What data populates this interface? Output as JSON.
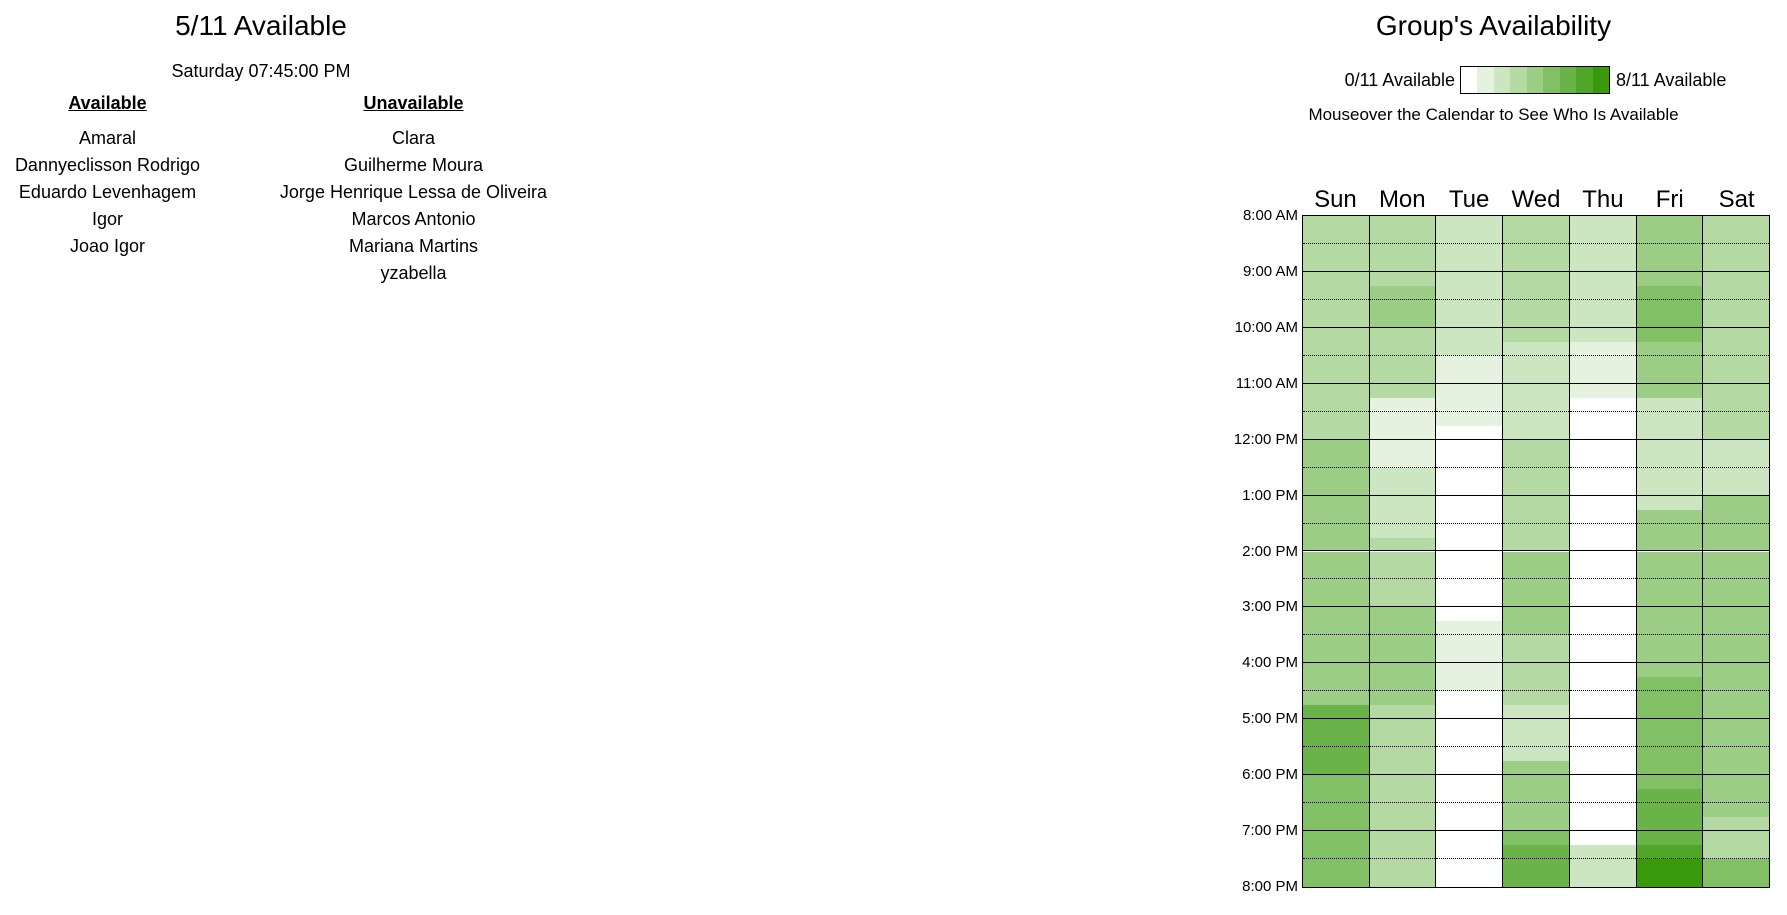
{
  "left_panel": {
    "title": "5/11 Available",
    "time": "Saturday 07:45:00 PM",
    "available_heading": "Available",
    "unavailable_heading": "Unavailable",
    "available": [
      "Amaral",
      "Dannyeclisson Rodrigo",
      "Eduardo Levenhagem",
      "Igor",
      "Joao Igor"
    ],
    "unavailable": [
      "Clara",
      "Guilherme Moura",
      "Jorge Henrique Lessa de Oliveira",
      "Marcos Antonio",
      "Mariana Martins",
      "yzabella"
    ]
  },
  "right_panel": {
    "title": "Group's Availability",
    "legend_min": "0/11 Available",
    "legend_max": "8/11 Available",
    "hint": "Mouseover the Calendar to See Who Is Available"
  },
  "legend_colors": [
    "#ffffff",
    "#e6f2e0",
    "#cde6c2",
    "#b4d9a3",
    "#9bcd85",
    "#82c066",
    "#69b348",
    "#50a629",
    "#389a0b"
  ],
  "days": [
    "Sun",
    "Mon",
    "Tue",
    "Wed",
    "Thu",
    "Fri",
    "Sat"
  ],
  "time_labels": [
    "8:00 AM",
    "9:00 AM",
    "10:00 AM",
    "11:00 AM",
    "12:00 PM",
    "1:00 PM",
    "2:00 PM",
    "3:00 PM",
    "4:00 PM",
    "5:00 PM",
    "6:00 PM",
    "7:00 PM",
    "8:00 PM"
  ],
  "availability_counts": {
    "Sun": [
      3,
      3,
      3,
      3,
      3,
      3,
      3,
      3,
      3,
      3,
      3,
      3,
      3,
      3,
      3,
      3,
      3,
      3,
      4,
      4,
      4,
      4,
      4,
      4,
      4,
      4,
      4,
      4,
      4,
      4,
      4,
      4,
      4,
      4,
      4,
      4,
      4,
      4,
      4,
      4,
      6,
      6,
      6,
      6,
      6,
      6,
      5,
      5,
      5,
      5,
      5,
      5,
      5,
      5,
      5,
      5
    ],
    "Mon": [
      3,
      3,
      3,
      3,
      3,
      3,
      3,
      3,
      4,
      4,
      4,
      4,
      3,
      3,
      3,
      3,
      3,
      3,
      3,
      3,
      1,
      1,
      1,
      1,
      1,
      1,
      1,
      1,
      2,
      2,
      2,
      2,
      2,
      2,
      2,
      2,
      3,
      3,
      3,
      3,
      3,
      3,
      3,
      3,
      4,
      4,
      4,
      4,
      4,
      4,
      4,
      4,
      4,
      4,
      4,
      4,
      3,
      3,
      3,
      3,
      3,
      3,
      3,
      3,
      3,
      3,
      3,
      3,
      3,
      3,
      3,
      3,
      3,
      3,
      3,
      3,
      3,
      3
    ],
    "Tue": [
      2,
      2,
      2,
      2,
      2,
      2,
      2,
      2,
      2,
      2,
      2,
      2,
      2,
      2,
      2,
      2,
      1,
      1,
      1,
      1,
      1,
      1,
      1,
      1,
      0,
      0,
      0,
      0,
      0,
      0,
      0,
      0,
      0,
      0,
      0,
      0,
      0,
      0,
      0,
      0,
      0,
      0,
      0,
      0,
      0,
      0,
      0,
      0,
      1,
      1,
      1,
      1,
      1,
      1,
      1,
      1,
      0,
      0,
      0,
      0,
      0,
      0,
      0,
      0,
      0,
      0,
      0,
      0,
      0,
      0,
      0,
      0,
      0,
      0,
      0,
      0,
      0,
      0,
      0,
      0
    ],
    "Wed": [
      3,
      3,
      3,
      3,
      3,
      3,
      3,
      3,
      3,
      3,
      3,
      3,
      3,
      3,
      3,
      3,
      2,
      2,
      2,
      2,
      2,
      2,
      2,
      2,
      2,
      2,
      2,
      2,
      2,
      2,
      3,
      3,
      3,
      3,
      3,
      3,
      3,
      3,
      3,
      3,
      3,
      3,
      3,
      3,
      4,
      4,
      4,
      4,
      4,
      4,
      4,
      4,
      4,
      4,
      4,
      4,
      3,
      3,
      3,
      3,
      3,
      3,
      3,
      3,
      2,
      2,
      2,
      2,
      2,
      2,
      2,
      2,
      4,
      4,
      4,
      4,
      4,
      4,
      4,
      4,
      4,
      4,
      5,
      5,
      6,
      6,
      6,
      6,
      6,
      6
    ],
    "Thu": [
      2,
      2,
      2,
      2,
      2,
      2,
      2,
      2,
      2,
      2,
      2,
      2,
      2,
      2,
      2,
      2,
      1,
      1,
      1,
      1,
      1,
      1,
      1,
      1,
      0,
      0,
      0,
      0,
      0,
      0,
      0,
      0,
      0,
      0,
      0,
      0,
      0,
      0,
      0,
      0,
      0,
      0,
      0,
      0,
      0,
      0,
      0,
      0,
      0,
      0,
      0,
      0,
      0,
      0,
      0,
      0,
      0,
      0,
      0,
      0,
      0,
      0,
      0,
      0,
      0,
      0,
      0,
      0,
      0,
      0,
      0,
      0,
      0,
      0,
      0,
      0,
      0,
      0,
      0,
      0,
      0,
      0,
      0,
      0,
      2,
      2,
      2,
      2,
      2,
      2
    ],
    "Fri": [
      4,
      4,
      4,
      4,
      4,
      4,
      4,
      4,
      5,
      5,
      5,
      5,
      5,
      5,
      5,
      5,
      4,
      4,
      4,
      4,
      4,
      4,
      4,
      4,
      2,
      2,
      2,
      2,
      2,
      2,
      2,
      2,
      2,
      2,
      2,
      2,
      2,
      2,
      2,
      2,
      4,
      4,
      4,
      4,
      4,
      4,
      4,
      4,
      4,
      4,
      4,
      4,
      4,
      4,
      4,
      4,
      4,
      4,
      4,
      4,
      4,
      4,
      4,
      4,
      5,
      5,
      5,
      5,
      5,
      5,
      5,
      5,
      5,
      5,
      5,
      5,
      5,
      5,
      5,
      5,
      6,
      6,
      6,
      6,
      6,
      6,
      6,
      6,
      7,
      7,
      8,
      8,
      8,
      8
    ],
    "Sat": [
      3,
      3,
      3,
      3,
      3,
      3,
      3,
      3,
      3,
      3,
      3,
      3,
      3,
      3,
      3,
      3,
      3,
      3,
      3,
      3,
      3,
      3,
      3,
      3,
      3,
      3,
      3,
      3,
      3,
      3,
      3,
      3,
      2,
      2,
      2,
      2,
      2,
      2,
      2,
      2,
      4,
      4,
      4,
      4,
      4,
      4,
      4,
      4,
      4,
      4,
      4,
      4,
      4,
      4,
      4,
      4,
      4,
      4,
      4,
      4,
      4,
      4,
      4,
      4,
      4,
      4,
      4,
      4,
      4,
      4,
      4,
      4,
      4,
      4,
      4,
      4,
      4,
      4,
      4,
      4,
      4,
      4,
      4,
      4,
      4,
      4,
      4,
      4,
      3,
      3,
      3,
      3,
      3,
      3,
      5,
      5,
      5,
      5,
      5,
      5
    ]
  }
}
